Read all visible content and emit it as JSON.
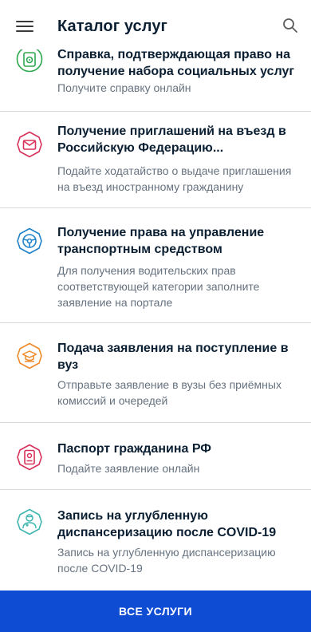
{
  "header": {
    "title": "Каталог услуг",
    "menu_icon": "hamburger-menu-icon",
    "search_icon": "search-icon"
  },
  "services": [
    {
      "title_line1": "Справка, подтверждающая право на",
      "title_line2": "получение набора социальных услуг",
      "desc_line1": "Получите справку онлайн",
      "icon": "certificate-icon",
      "color": "#2ea84f"
    },
    {
      "title_line1": "Получение приглашений на въезд в",
      "title_line2": "Российскую Федерацию...",
      "desc_line1": "Подайте ходатайство о выдаче приглашения",
      "desc_line2": "на въезд иностранному гражданину",
      "icon": "invitation-envelope-icon",
      "color": "#d8305a"
    },
    {
      "title_line1": "Получение права на управление",
      "title_line2": "транспортным средством",
      "desc_line1": "Для получения водительских прав",
      "desc_line2": "соответствующей категории заполните",
      "desc_line3": "заявление на портале",
      "icon": "steering-wheel-icon",
      "color": "#1f82c9"
    },
    {
      "title_line1": "Подача заявления на поступление в",
      "title_line2": "вуз",
      "desc_line1": "Отправьте заявление в вузы без приёмных",
      "desc_line2": "комиссий и очередей",
      "icon": "graduation-cap-icon",
      "color": "#ee8a28"
    },
    {
      "title_line1": "Паспорт гражданина РФ",
      "desc_line1": "Подайте заявление онлайн",
      "icon": "passport-icon",
      "color": "#d8305a"
    },
    {
      "title_line1": "Запись на углубленную",
      "title_line2": "диспансеризацию после COVID-19",
      "desc_line1": "Запись на углубленную диспансеризацию",
      "desc_line2": "после COVID-19",
      "icon": "doctor-icon",
      "color": "#3fb6b0"
    }
  ],
  "footer": {
    "button_label": "ВСЕ УСЛУГИ",
    "button_color": "#0d4cd3"
  }
}
